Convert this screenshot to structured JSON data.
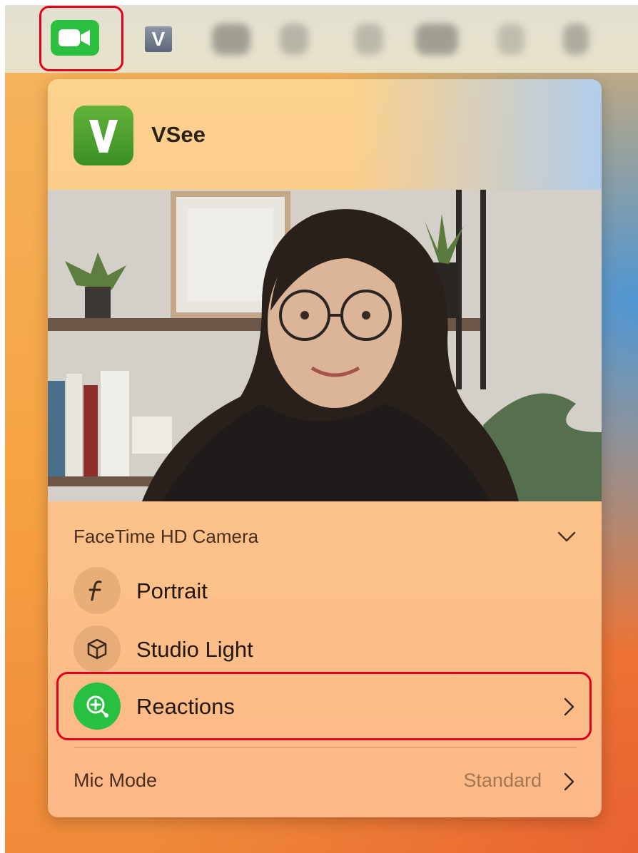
{
  "menubar": {
    "facetime_icon": "video-camera-icon",
    "vsee_letter": "V"
  },
  "panel": {
    "app_icon_letter": "V",
    "app_name": "VSee",
    "camera_section_title": "FaceTime HD Camera",
    "items": [
      {
        "label": "Portrait",
        "icon": "f-aperture-icon"
      },
      {
        "label": "Studio Light",
        "icon": "cube-icon"
      },
      {
        "label": "Reactions",
        "icon": "reactions-icon"
      }
    ],
    "mic_mode_label": "Mic Mode",
    "mic_mode_value": "Standard"
  },
  "colors": {
    "highlight": "#e3001b",
    "facetime_green": "#2dbf3f",
    "reactions_green": "#27c041"
  }
}
